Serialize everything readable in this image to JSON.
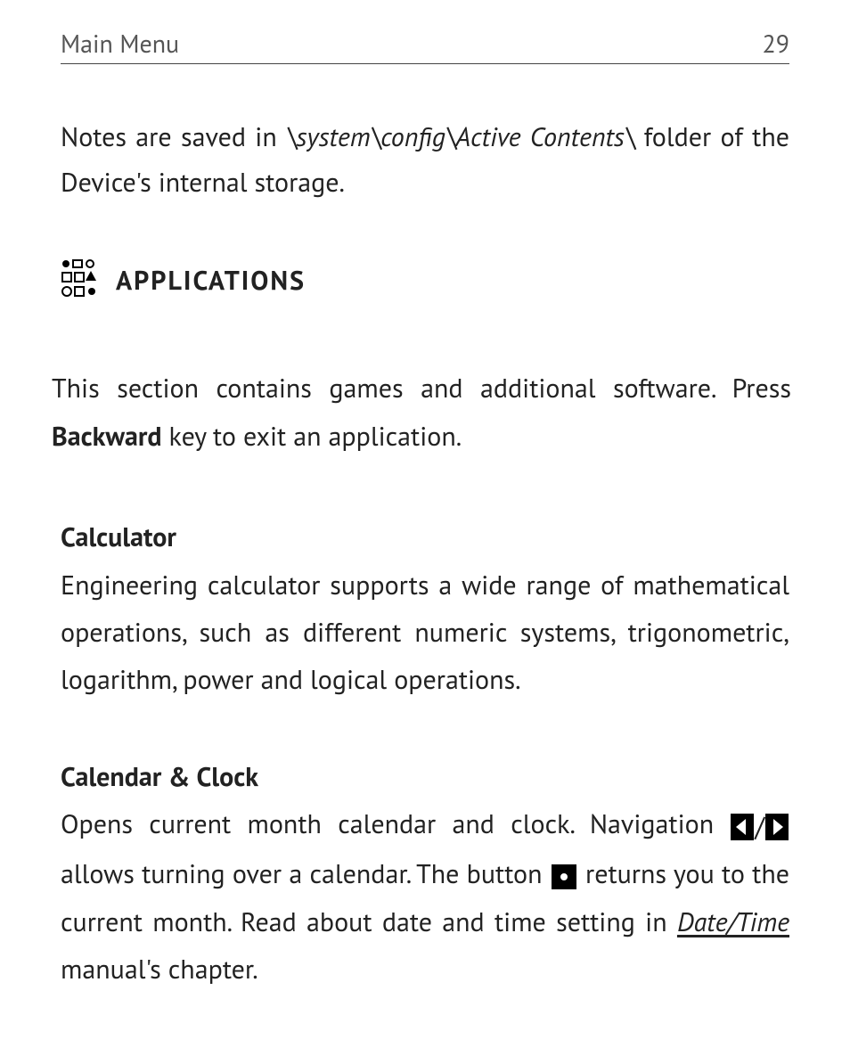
{
  "header": {
    "title": "Main Menu",
    "page": "29"
  },
  "intro": {
    "pre": "Notes are saved in ",
    "path": "\\system\\config\\Active Contents\\",
    "post": " folder of the Device's internal storage."
  },
  "section": {
    "heading": "APPLICATIONS",
    "desc_pre": "This section contains games and additional software. Press ",
    "desc_bold": "Backward",
    "desc_post": " key to exit an application."
  },
  "calculator": {
    "title": "Calculator",
    "body": "Engineering calculator supports a wide range of mathematical operations, such as different numeric systems, trigonometric, logarithm, power and logical operations."
  },
  "calendar": {
    "title": "Calendar & Clock",
    "body_pre": "Opens current month calendar and clock. Navigation ",
    "slash": "/",
    "body_mid": " allows turning over a calendar. The button ",
    "body_post1": " returns you to the current month. Read about date and time setting in ",
    "link": "Date/Time",
    "body_post2": " manual's chapter."
  }
}
